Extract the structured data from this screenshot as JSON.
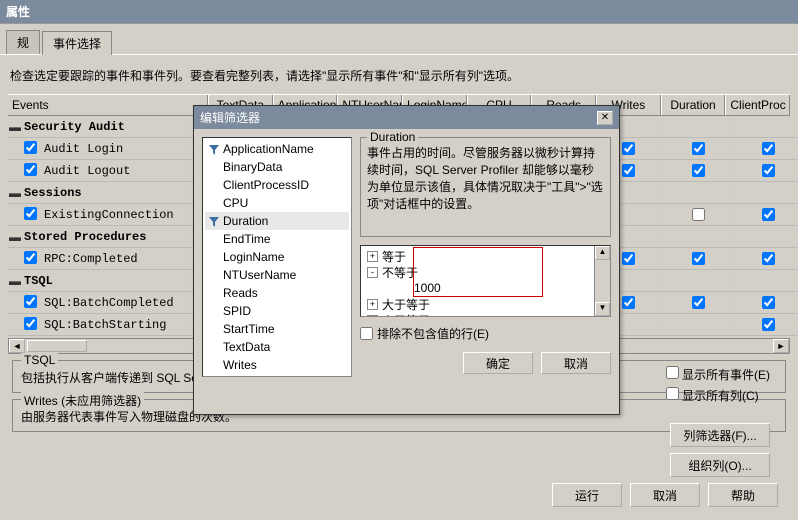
{
  "window": {
    "title": "属性"
  },
  "tabs": {
    "general": "规",
    "events": "事件选择"
  },
  "hint": "检查选定要跟踪的事件和事件列。要查看完整列表，请选择\"显示所有事件\"和\"显示所有列\"选项。",
  "events_header": "Events",
  "columns_full": [
    "TextData",
    "ApplicationName",
    "NTUserName",
    "LoginName",
    "CPU",
    "Reads",
    "Writes",
    "Duration",
    "ClientProcessID"
  ],
  "columns_visible": [
    "Writes",
    "Duration",
    "ClientProc"
  ],
  "event_tree": [
    {
      "type": "cat",
      "label": "Security Audit",
      "expanded": true
    },
    {
      "type": "item",
      "label": "Audit Login",
      "checked": true,
      "cols": [
        true,
        true,
        true
      ]
    },
    {
      "type": "item",
      "label": "Audit Logout",
      "checked": true,
      "cols": [
        true,
        true,
        true
      ]
    },
    {
      "type": "cat",
      "label": "Sessions",
      "expanded": true
    },
    {
      "type": "item",
      "label": "ExistingConnection",
      "checked": true,
      "cols": [
        null,
        false,
        true
      ]
    },
    {
      "type": "cat",
      "label": "Stored Procedures",
      "expanded": true
    },
    {
      "type": "item",
      "label": "RPC:Completed",
      "checked": true,
      "cols": [
        true,
        true,
        true
      ]
    },
    {
      "type": "cat",
      "label": "TSQL",
      "expanded": true
    },
    {
      "type": "item",
      "label": "SQL:BatchCompleted",
      "checked": true,
      "cols": [
        true,
        true,
        true
      ]
    },
    {
      "type": "item",
      "label": "SQL:BatchStarting",
      "checked": true,
      "cols": [
        null,
        null,
        true
      ]
    }
  ],
  "groupbox1": {
    "title": "TSQL",
    "text": "包括执行从客户端传递到 SQL Serv"
  },
  "groupbox2": {
    "title": "Writes (未应用筛选器)",
    "text": "由服务器代表事件写入物理磁盘的次数。"
  },
  "side": {
    "show_all_events_label": "显示所有事件(E)",
    "show_all_columns_label": "显示所有列(C)",
    "show_all_events_checked": false,
    "show_all_columns_checked": false,
    "column_filter_btn": "列筛选器(F)...",
    "organize_cols_btn": "组织列(O)..."
  },
  "bottom": {
    "run": "运行",
    "cancel": "取消",
    "help": "帮助"
  },
  "dialog": {
    "title": "编辑筛选器",
    "columns": [
      "ApplicationName",
      "BinaryData",
      "ClientProcessID",
      "CPU",
      "Duration",
      "EndTime",
      "LoginName",
      "NTUserName",
      "Reads",
      "SPID",
      "StartTime",
      "TextData",
      "Writes"
    ],
    "selected_column": "Duration",
    "filtered_columns": [
      "ApplicationName",
      "Duration"
    ],
    "desc_title": "Duration",
    "desc_text": "事件占用的时间。尽管服务器以微秒计算持续时间，SQL Server Profiler 却能够以毫秒为单位显示该值，具体情况取决于\"工具\">\"选项\"对话框中的设置。",
    "tree": [
      {
        "pm": "+",
        "label": "等于",
        "indent": 0
      },
      {
        "pm": "-",
        "label": "不等于",
        "indent": 0
      },
      {
        "pm": "",
        "label": "1000",
        "indent": 2
      },
      {
        "pm": "+",
        "label": "大于等于",
        "indent": 0
      },
      {
        "pm": "+",
        "label": "小于等于",
        "indent": 0
      }
    ],
    "exclude_label": "排除不包含值的行(E)",
    "exclude_checked": false,
    "ok": "确定",
    "cancel": "取消"
  }
}
